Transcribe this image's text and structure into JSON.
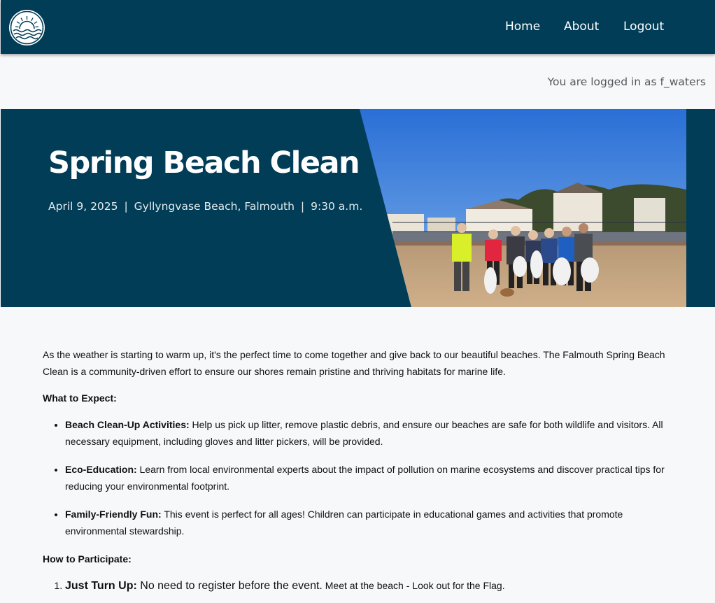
{
  "nav": {
    "home_label": "Home",
    "about_label": "About",
    "logout_label": "Logout"
  },
  "user": {
    "status_text": "You are logged in as f_waters"
  },
  "hero": {
    "title": "Spring Beach Clean",
    "date": "April 9, 2025",
    "location": "Gyllyngvase Beach, Falmouth",
    "time": "9:30 a.m.",
    "separator": "|"
  },
  "article": {
    "intro": "As the weather is starting to warm up, it's the perfect time to come together and give back to our beautiful beaches. The Falmouth Spring Beach Clean is a community-driven effort to ensure our shores remain pristine and thriving habitats for marine life.",
    "expect_heading": "What to Expect:",
    "expect_items": [
      {
        "title": "Beach Clean-Up Activities:",
        "text": " Help us pick up litter, remove plastic debris, and ensure our beaches are safe for both wildlife and visitors. All necessary equipment, including gloves and litter pickers, will be provided."
      },
      {
        "title": "Eco-Education:",
        "text": " Learn from local environmental experts about the impact of pollution on marine ecosystems and discover practical tips for reducing your environmental footprint."
      },
      {
        "title": "Family-Friendly Fun:",
        "text": " This event is perfect for all ages! Children can participate in educational games and activities that promote environmental stewardship."
      }
    ],
    "participate_heading": "How to Participate:",
    "participate_items": [
      {
        "title": "Just Turn Up:",
        "text_big": " No need to register before the event.",
        "text_small": " Meet at the beach - Look out for the Flag."
      }
    ]
  },
  "colors": {
    "navbar_bg": "#023d57",
    "hero_bg": "#023d57",
    "page_bg": "#f7f8fa"
  },
  "icons": {
    "logo": "sun-over-waves-logo"
  }
}
